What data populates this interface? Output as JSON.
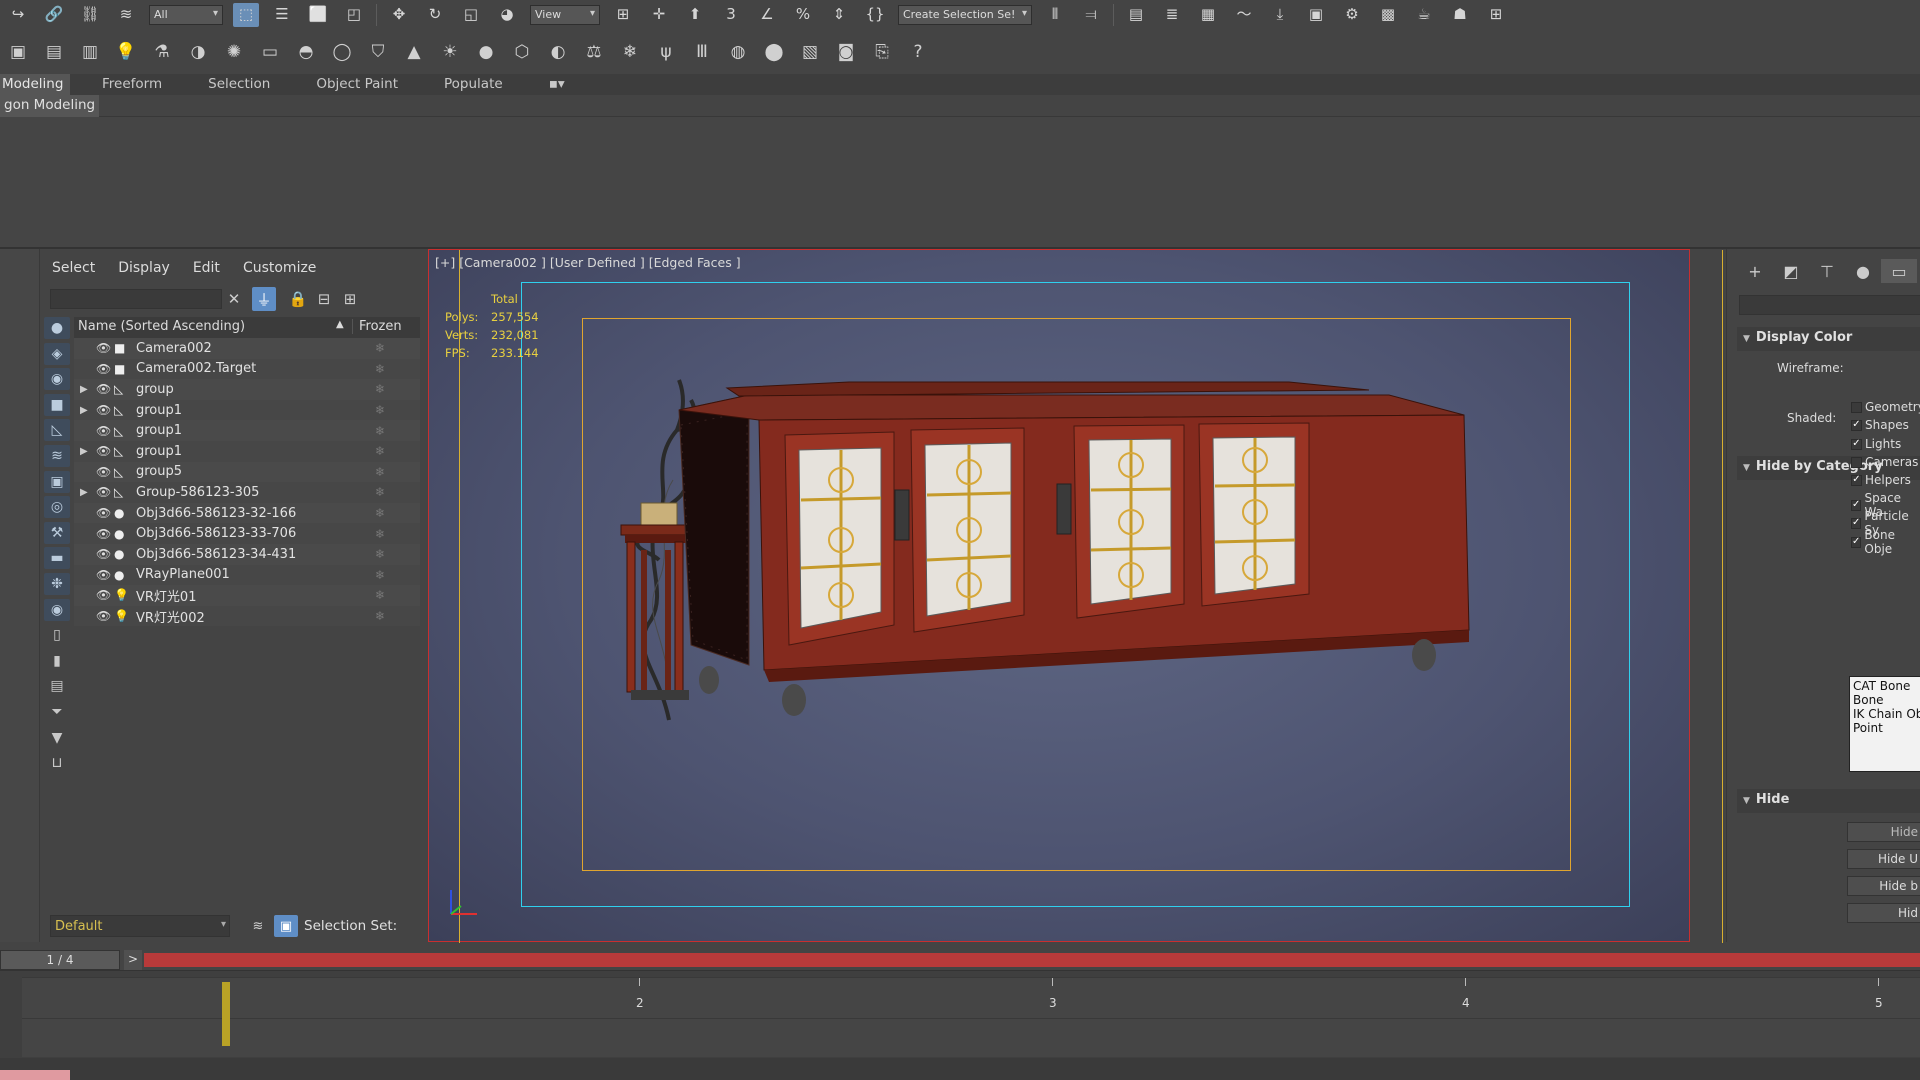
{
  "toolbar": {
    "selection_filter": "All",
    "view_dropdown": "View",
    "create_selection_set": "Create Selection Se!"
  },
  "ribbon": {
    "tabs": [
      "Modeling",
      "Freeform",
      "Selection",
      "Object Paint",
      "Populate"
    ],
    "active_subtab": "gon Modeling"
  },
  "explorer": {
    "menu": [
      "Select",
      "Display",
      "Edit",
      "Customize"
    ],
    "column_name": "Name (Sorted Ascending)",
    "column_frozen": "Frozen",
    "rows": [
      {
        "name": "Camera002",
        "expandable": false,
        "type_icon": "camera-icon"
      },
      {
        "name": "Camera002.Target",
        "expandable": false,
        "type_icon": "camera-icon"
      },
      {
        "name": "group",
        "expandable": true,
        "type_icon": "group-icon"
      },
      {
        "name": "group1",
        "expandable": true,
        "type_icon": "group-icon"
      },
      {
        "name": "group1",
        "expandable": false,
        "type_icon": "group-icon"
      },
      {
        "name": "group1",
        "expandable": true,
        "type_icon": "group-icon"
      },
      {
        "name": "group5",
        "expandable": false,
        "type_icon": "group-icon"
      },
      {
        "name": "Group-586123-305",
        "expandable": true,
        "type_icon": "group-icon"
      },
      {
        "name": "Obj3d66-586123-32-166",
        "expandable": false,
        "type_icon": "geometry-icon"
      },
      {
        "name": "Obj3d66-586123-33-706",
        "expandable": false,
        "type_icon": "geometry-icon"
      },
      {
        "name": "Obj3d66-586123-34-431",
        "expandable": false,
        "type_icon": "geometry-icon"
      },
      {
        "name": "VRayPlane001",
        "expandable": false,
        "type_icon": "geometry-icon"
      },
      {
        "name": "VR灯光01",
        "expandable": false,
        "type_icon": "light-icon"
      },
      {
        "name": "VR灯光002",
        "expandable": false,
        "type_icon": "light-icon"
      }
    ],
    "layer": "Default",
    "selection_set_label": "Selection Set:"
  },
  "viewport": {
    "label": "[+] [Camera002 ] [User Defined ] [Edged Faces ]",
    "stats_header": "Total",
    "polys_label": "Polys:",
    "polys_value": "257,554",
    "verts_label": "Verts:",
    "verts_value": "232,081",
    "fps_label": "FPS:",
    "fps_value": "233.144"
  },
  "command_panel": {
    "display_color_title": "Display Color",
    "wireframe_label": "Wireframe:",
    "shaded_label": "Shaded:",
    "hide_by_category_title": "Hide by Category",
    "categories": [
      {
        "label": "Geometry",
        "checked": false
      },
      {
        "label": "Shapes",
        "checked": true
      },
      {
        "label": "Lights",
        "checked": true
      },
      {
        "label": "Cameras",
        "checked": false
      },
      {
        "label": "Helpers",
        "checked": true
      },
      {
        "label": "Space Wa",
        "checked": true
      },
      {
        "label": "Particle Sy",
        "checked": true
      },
      {
        "label": "Bone Obje",
        "checked": true
      }
    ],
    "category_list": [
      "CAT Bone",
      "Bone",
      "IK Chain Obj",
      "Point"
    ],
    "hide_title": "Hide",
    "hide_buttons": [
      "Hide",
      "Hide U",
      "Hide b",
      "Hid"
    ]
  },
  "timeline": {
    "frame_display": "1 / 4",
    "next_label": ">",
    "ticks": [
      "2",
      "3",
      "4",
      "5"
    ]
  },
  "colors": {
    "viewport_border": "#c92f2f",
    "safe_frame_outer": "#d8b030",
    "safe_frame_cyan": "#2fd0ee",
    "stats_text": "#e8d040",
    "time_slider": "#b83a3a",
    "active_blue": "#5f8ec6"
  }
}
